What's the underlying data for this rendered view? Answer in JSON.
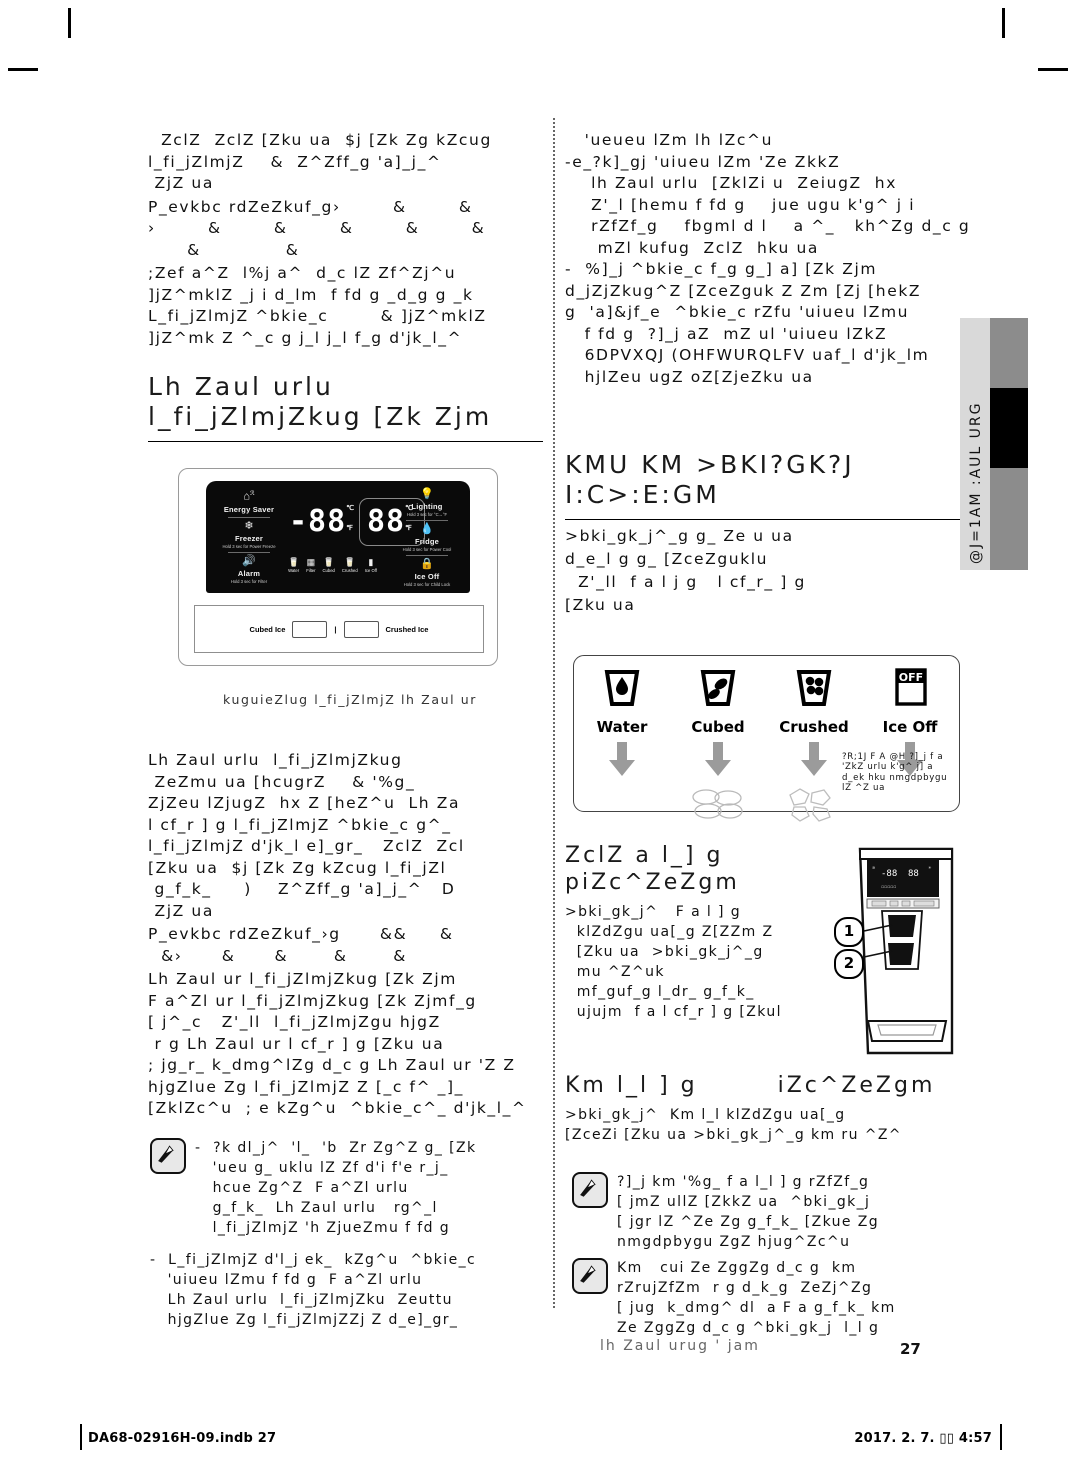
{
  "document": {
    "kind": "appliance-manual-page",
    "page_number": "27"
  },
  "crop_marks": [
    "top-left",
    "top-right",
    "bottom-left",
    "bottom-right"
  ],
  "left_column": {
    "intro_paragraph": "  ZclZ  ZclZ [Zku ua  $j [Zk Zg kZcug\nl_fi_jZlmjZ    &  Z^Zff_g 'a]_j_^\n ZjZ ua",
    "table_line_1": "P_evkbc rdZeZkuf_g›        &        &",
    "table_line_2": "›        &        &        &        &        &",
    "table_line_3": "      &             &",
    "body_paragraph": ";Zef a^Z  l%j a^  d_c lZ Zf^Zj^u\n]jZ^mklZ _j i d_lm  f fd g _d_g g _k\nL_fi_jZlmjZ ^bkie_c        & ]jZ^mklZ\n]jZ^mk Z ^_c g j_l j_l f_g d'jk_l_^",
    "heading": {
      "line1": "Lh Zaul urlu",
      "line2": "l_fi_jZlmjZkug [Zk Zjm"
    },
    "figure_caption": "kuguieZlug l_fi_jZlmjZ  lh Zaul ur",
    "paragraph_2": "Lh Zaul urlu  l_fi_jZlmjZkug\n ZeZmu ua [hcugrZ    & '%g_\nZjZeu lZjugZ  hx Z [heZ^u  Lh Za\nl cf_r ] g l_fi_jZlmjZ ^bkie_c g^_\nl_fi_jZlmjZ d'jk_l e]_gr_   ZclZ  Zcl\n[Zku ua  $j [Zk Zg kZcug l_fi_jZl\n g_f_k_     )    Z^Zff_g 'a]_j_^   D\n ZjZ ua",
    "table_line_4": "P_evkbc rdZeZkuf_›g      &&     &",
    "table_line_5": "  &›      &      &       &       &",
    "paragraph_3": "Lh Zaul ur l_fi_jZlmjZkug [Zk Zjm\nF a^Zl ur l_fi_jZlmjZkug [Zk Zjmf_g\n[ j^_c   Z'_ll  l_fi_jZlmjZgu hjgZ\n r g Lh Zaul ur l cf_r ] g [Zku ua\n; jg_r_ k_dmg^lZg d_c g Lh Zaul ur 'Z Z\nhjgZlue Zg l_fi_jZlmjZ Z [_c f^ _]_\n[ZklZc^u  ; e kZg^u  ^bkie_c^_ d'jk_l_^",
    "notes": [
      {
        "icon": "note-pencil-icon",
        "text": "-  ?k dl_j^  'l_  'b  Zr Zg^Z g_ [Zk\n   'ueu g_ uklu lZ Zf d'i f'e r_j_\n   hcue Zg^Z  F a^Zl urlu\n   g_f_k_  Lh Zaul urlu   rg^_l\n   l_fi_jZlmjZ 'h ZjueZmu f fd g"
      },
      {
        "icon": "note-pencil-icon",
        "text": "-  L_fi_jZlmjZ d'l_j ek_  kZg^u  ^bkie_c\n   'uiueu lZmu f fd g  F a^Zl urlu\n   Lh Zaul urlu  l_fi_jZlmjZku  Zeuttu\n   hjgZlue Zg l_fi_jZlmjZZj Z d_e]_gr_"
      }
    ]
  },
  "right_column": {
    "intro_paragraph": "   'ueueu lZm lh lZc^u\n-e_?k]_gj 'uiueu lZm 'Ze ZkkZ\n    lh Zaul urlu  [ZklZi u  ZeiugZ  hx\n    Z'_l [hemu f fd g    jue ugu k'g^ j i\n    rZfZf_g    fbgml d l    a ^_   kh^Zg d_c g\n     mZl kufug  ZclZ  hku ua\n-  %]_j ^bkie_c f_g g_] a] [Zk Zjm\nd_jZjZkug^Z [ZceZguk Z Zm [Zj [hekZ\ng  'a]&jf_e  ^bkie_c rZfu 'uiueu lZmu\n   f fd g  ?]_j aZ  mZ ul 'uiueu lZkZ\n   6DPVXQJ (OHFWURQLFV uaf_l d'jk_lm\n   hjlZeu ugZ oZ[ZjeZku ua"
  },
  "dispenser_section": {
    "heading": {
      "line1": "KMU KM >BKI?GK?J",
      "line2": "I:C>:E:GM"
    },
    "body": ">bki_gk_j^_g g_ Ze u ua\nd_e_l g g_ [ZceZguklu\n  Z'_ll  f a l j g   l cf_r_ ] g\n[Zku ua",
    "figure": {
      "items": [
        {
          "name": "water-dispense-option",
          "icon": "water-glass-icon",
          "label": "Water"
        },
        {
          "name": "cubed-ice-option",
          "icon": "cubed-ice-glass-icon",
          "label": "Cubed"
        },
        {
          "name": "crushed-ice-option",
          "icon": "crushed-ice-glass-icon",
          "label": "Crushed"
        },
        {
          "name": "ice-off-option",
          "icon": "ice-off-icon",
          "label": "Ice Off"
        }
      ],
      "note": "?R;1J F A @H\n?]_j f a 'ZkZ urlu\nk'g^ j]  a d_ek  hku\nnmgdpbygu lZ ^Z ua"
    }
  },
  "control_panel_figure": {
    "left_keys": [
      {
        "name": "energy-saver-key",
        "icon": "energy-saver-icon",
        "label": "Energy Saver",
        "sub": ""
      },
      {
        "name": "freezer-key",
        "icon": "snowflake-icon",
        "label": "Freezer",
        "sub": "Hold 3 sec for\nPower Freeze"
      },
      {
        "name": "alarm-key",
        "icon": "alarm-speaker-icon",
        "label": "Alarm",
        "sub": "Hold 3 sec for Filter"
      }
    ],
    "right_keys": [
      {
        "name": "lighting-key",
        "icon": "bulb-icon",
        "label": "Lighting",
        "sub": "Hold 3 sec for °C↔°F"
      },
      {
        "name": "fridge-key",
        "icon": "water-drop-icon",
        "label": "Fridge",
        "sub": "Hold 3 sec for\nPower Cool"
      },
      {
        "name": "ice-off-key",
        "icon": "lock-icon",
        "label": "Ice Off",
        "sub": "Hold 3 sec for Child Lock"
      }
    ],
    "freezer_display": {
      "value": "-88",
      "unit_c": "℃",
      "unit_f": "℉"
    },
    "fridge_display": {
      "value": "88",
      "unit_c": "℃",
      "unit_f": "℉"
    },
    "status_icons": [
      {
        "name": "water-status-icon",
        "label": "Water"
      },
      {
        "name": "filter-status-icon",
        "label": "Filter"
      },
      {
        "name": "cubed-status-icon",
        "label": "Cubed"
      },
      {
        "name": "crushed-status-icon",
        "label": "Crushed"
      },
      {
        "name": "ice-off-status-icon",
        "label": "Ice Off"
      }
    ],
    "bottom_bar": {
      "left_label": "Cubed Ice",
      "separator": "|",
      "right_label": "Crushed Ice"
    }
  },
  "dispenser_photo": {
    "callouts": [
      {
        "number": "1"
      },
      {
        "number": "2"
      }
    ]
  },
  "side_tab": {
    "text": "@J=1AM :AUL URG"
  },
  "lower_right": {
    "heading_1": {
      "line1": "ZclZ  a l_] g",
      "line2": "piZc^ZeZgm"
    },
    "body_1": ">bki_gk_j^   F a l ] g\n  klZdZgu ua[_g Z[ZZm Z\n  [Zku ua  >bki_gk_j^_g\n  mu ^Z^uk\n  mf_guf_g l_dr_ g_f_k_\n  ujujm  f a l cf_r ] g [Zkul",
    "heading_2": {
      "line1": "Km l_l ] g",
      "line2": "iZc^ZeZgm"
    },
    "body_2": ">bki_gk_j^  Km l_l klZdZgu ua[_g\n[ZceZi [Zku ua >bki_gk_j^_g km ru ^Z^",
    "notes": [
      {
        "icon": "note-pencil-icon",
        "text": "?]_j km '%g_ f a l_l ] g rZfZf_g\n[ jmZ ullZ [ZkkZ ua  ^bki_gk_j\n[ jgr lZ ^Ze Zg g_f_k_ [Zkue Zg\nnmgdpbygu ZgZ hjug^Zc^u"
      },
      {
        "icon": "note-pencil-icon",
        "text": "Km   cui Ze ZggZg d_c g  km\nrZrujZfZm  r g d_k_g  ZeZj^Zg\n[ jug  k_dmg^ dl  a F a g_f_k_ km\nZe ZggZg d_c g ^bki_gk_j  l_l g"
      }
    ],
    "footer_line": "lh Zaul urug ' jam"
  },
  "footer": {
    "left": "DA68-02916H-09.indb   27",
    "right": "2017. 2. 7.   ▯▯ 4:57"
  }
}
